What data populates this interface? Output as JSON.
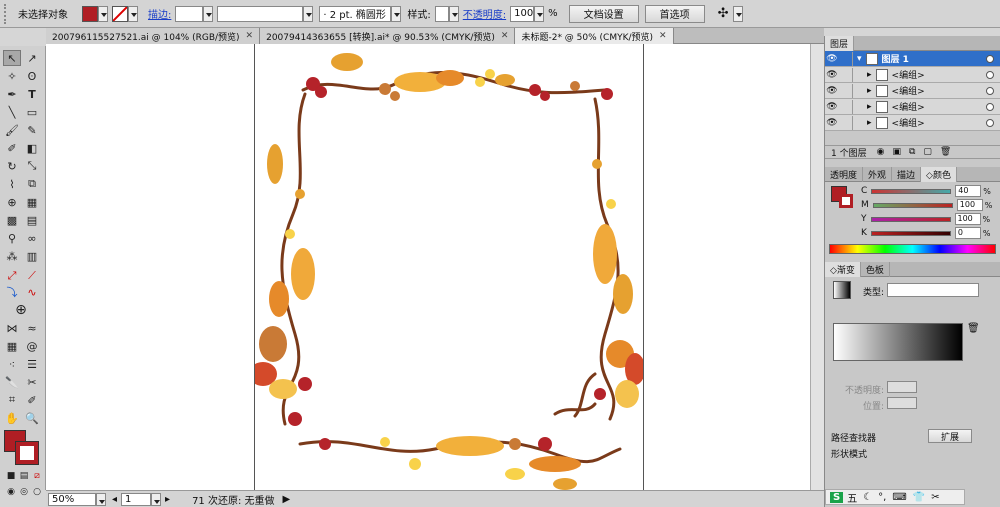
{
  "control_bar": {
    "selection_label": "未选择对象",
    "stroke_label": "描边:",
    "stroke_weight": "",
    "brush_value": "· 2 pt. 椭圆形",
    "style_label": "样式:",
    "opacity_label": "不透明度:",
    "opacity_value": "100",
    "opacity_unit": "%",
    "doc_setup_button": "文档设置",
    "prefs_button": "首选项",
    "fill_color": "#b01e24"
  },
  "tabs": [
    {
      "label": "200796115527521.ai @ 104% (RGB/预览)"
    },
    {
      "label": "20079414363655 [转换].ai* @ 90.53% (CMYK/预览)"
    },
    {
      "label": "未标题-2* @ 50% (CMYK/预览)"
    }
  ],
  "status": {
    "zoom": "50%",
    "page": "1",
    "history": "71 次还原: 无重做"
  },
  "layers_panel": {
    "title": "图层",
    "top_layer": "图层 1",
    "groups": [
      "<编组>",
      "<编组>",
      "<编组>",
      "<编组>"
    ],
    "count": "1 个图层"
  },
  "color_panel": {
    "tabs": [
      "透明度",
      "外观",
      "描边",
      "◇颜色"
    ],
    "channels": [
      {
        "name": "C",
        "value": "40"
      },
      {
        "name": "M",
        "value": "100"
      },
      {
        "name": "Y",
        "value": "100"
      },
      {
        "name": "K",
        "value": "0"
      }
    ],
    "unit": "%"
  },
  "gradient_panel": {
    "tabs": [
      "◇渐变",
      "色板"
    ],
    "type_label": "类型:",
    "opacity_label": "不透明度:",
    "location_label": "位置:"
  },
  "bottom_panel": {
    "label1": "路径查找器",
    "expand_button": "扩展",
    "label2": "形状模式"
  },
  "ime_bar": {
    "items": [
      "S",
      "五",
      "☾",
      "°,",
      "⌨",
      "👕",
      "✂"
    ]
  }
}
